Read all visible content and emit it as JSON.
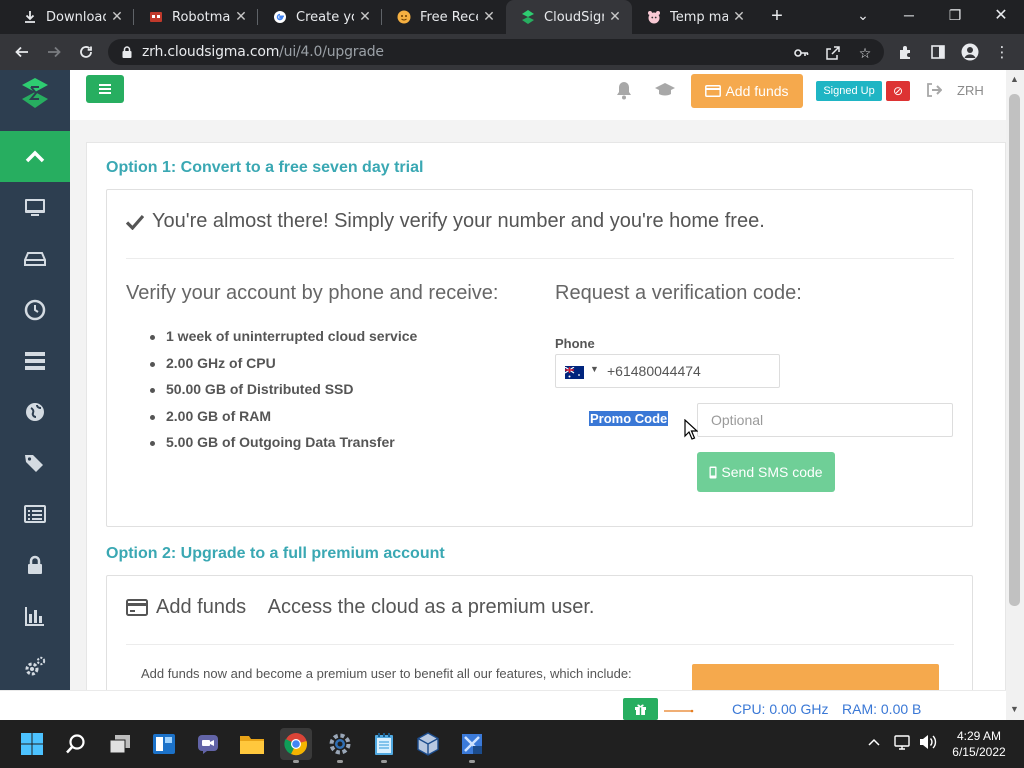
{
  "browser": {
    "tabs": [
      {
        "title": "Downloads",
        "icon": "download-icon",
        "active": false
      },
      {
        "title": "Robotman",
        "icon": "robot-icon",
        "active": false
      },
      {
        "title": "Create you",
        "icon": "google-icon",
        "active": false
      },
      {
        "title": "Free Receiv",
        "icon": "sms-icon",
        "active": false
      },
      {
        "title": "CloudSigm",
        "icon": "cloudsigma-icon",
        "active": true
      },
      {
        "title": "Temp mail",
        "icon": "tempmail-icon",
        "active": false
      }
    ],
    "url_host": "zrh.cloudsigma.com",
    "url_path": "/ui/4.0/upgrade"
  },
  "topbar": {
    "add_funds_label": "Add funds",
    "signed_up_label": "Signed Up",
    "region": "ZRH"
  },
  "option1": {
    "title": "Option 1: Convert to a free seven day trial",
    "headline": "You're almost there!  Simply verify your number and you're home free.",
    "left_heading": "Verify your account by phone and receive:",
    "benefits": [
      "1 week of uninterrupted cloud service",
      "2.00 GHz of CPU",
      "50.00 GB of Distributed SSD",
      "2.00 GB of RAM",
      "5.00 GB of Outgoing Data Transfer"
    ],
    "right_heading": "Request a verification code:",
    "phone_label": "Phone",
    "phone_value": "+61480044474",
    "phone_country": "AU",
    "promo_label": "Promo Code",
    "promo_placeholder": "Optional",
    "send_sms_label": "Send SMS code"
  },
  "option2": {
    "title": "Option 2: Upgrade to a full premium account",
    "headline_a": "Add funds",
    "headline_b": "Access the cloud as a premium user.",
    "description": "Add funds now and become a premium user to benefit all our features, which include:"
  },
  "status": {
    "cpu": "CPU: 0.00 GHz",
    "ram": "RAM: 0.00 B"
  },
  "taskbar": {
    "time": "4:29 AM",
    "date": "6/15/2022"
  },
  "colors": {
    "accent_green": "#27ae60",
    "teal": "#3aa8b3",
    "orange": "#f5a94d",
    "sidebar": "#2d3e50"
  }
}
